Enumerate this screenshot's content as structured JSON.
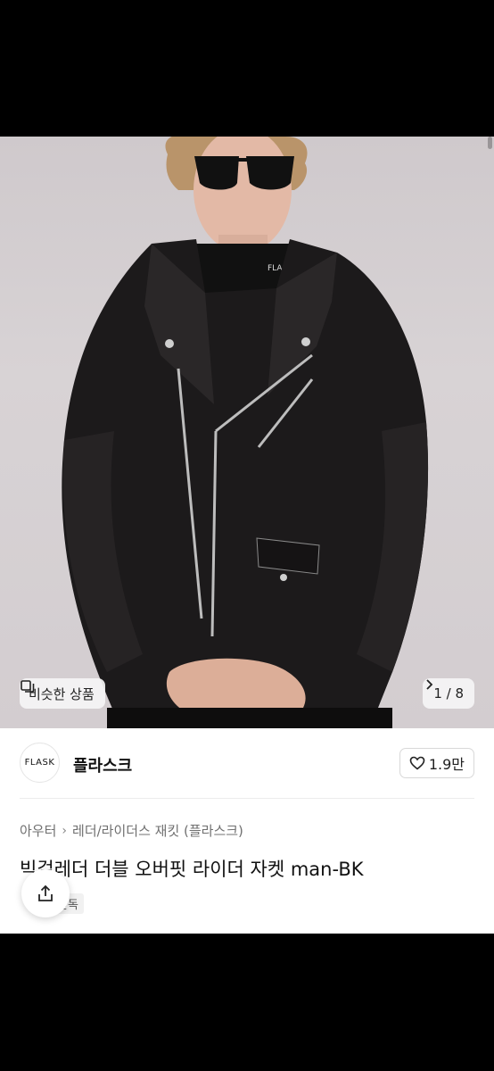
{
  "gallery": {
    "similar_label": "비슷한 상품",
    "counter_text": "1 / 8",
    "neck_logo": "FLASK"
  },
  "shop": {
    "logo_text": "FLASK",
    "name": "플라스크",
    "likes": "1.9만"
  },
  "breadcrumb": {
    "category": "아우터",
    "subcategory": "레더/라이더스 재킷 (플라스크)"
  },
  "product": {
    "title": "빅걸레더 더블 오버핏 라이더 자켓 man-BK",
    "tag": "단독"
  },
  "colors": {
    "background": "#000000",
    "image_bg": "#d3cdd0",
    "text": "#111111",
    "muted": "#707070"
  }
}
